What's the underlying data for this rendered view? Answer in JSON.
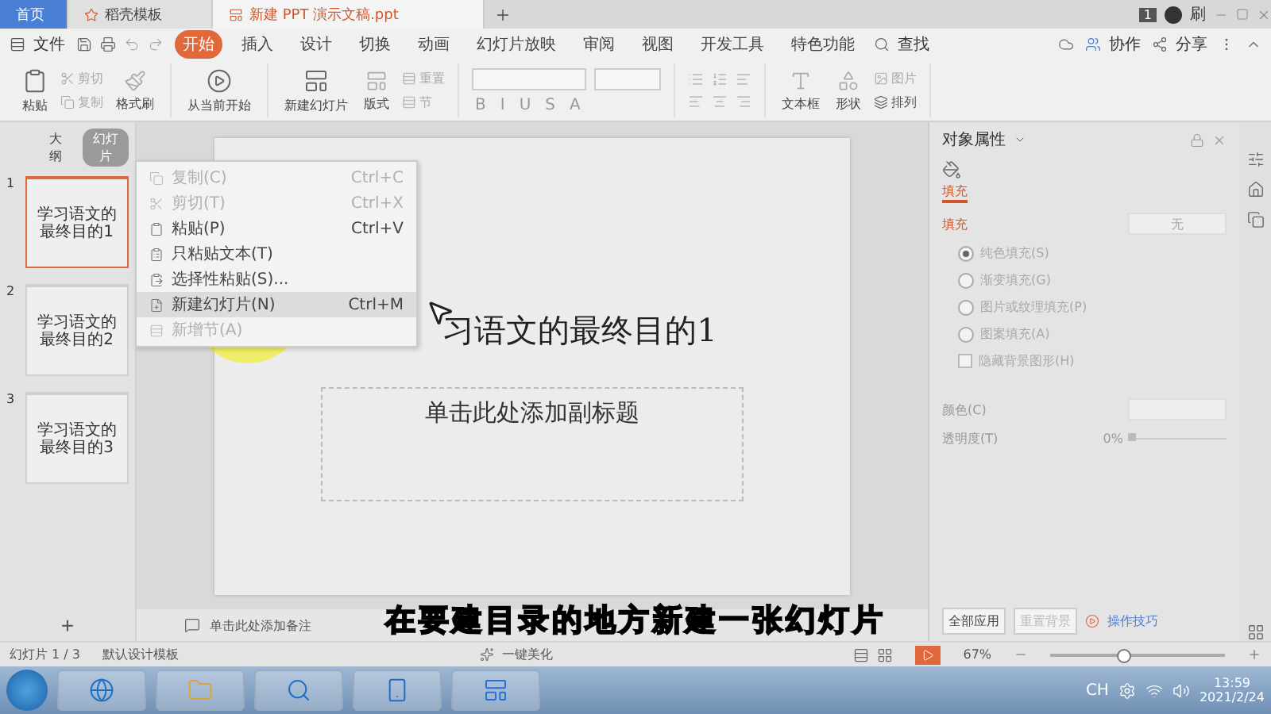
{
  "doc_tabs": [
    {
      "label": "首页",
      "kind": "home",
      "selected": false
    },
    {
      "label": "稻壳模板",
      "kind": "docer",
      "selected": false
    },
    {
      "label": "新建 PPT 演示文稿.ppt",
      "kind": "doc",
      "selected": true
    }
  ],
  "title_bar": {
    "badge": "1",
    "user": "刷"
  },
  "menu": {
    "file": "文件",
    "tabs": [
      {
        "label": "开始",
        "selected": true
      },
      {
        "label": "插入",
        "selected": false
      },
      {
        "label": "设计",
        "selected": false
      },
      {
        "label": "切换",
        "selected": false
      },
      {
        "label": "动画",
        "selected": false
      },
      {
        "label": "幻灯片放映",
        "selected": false
      },
      {
        "label": "审阅",
        "selected": false
      },
      {
        "label": "视图",
        "selected": false
      },
      {
        "label": "开发工具",
        "selected": false
      },
      {
        "label": "特色功能",
        "selected": false
      }
    ],
    "search": "查找",
    "collab": "协作",
    "share": "分享"
  },
  "ribbon": {
    "paste": "粘贴",
    "cut": "剪切",
    "copy": "复制",
    "format_painter": "格式刷",
    "play_from_current": "从当前开始",
    "new_slide": "新建幻灯片",
    "layout": "版式",
    "reset": "重置",
    "section": "节",
    "format_letters": [
      "B",
      "I",
      "U",
      "S",
      "A"
    ],
    "text_box": "文本框",
    "shape": "形状",
    "arrange": "排列",
    "picture": "图片"
  },
  "left_panel": {
    "tabs": [
      {
        "label": "大纲",
        "selected": false
      },
      {
        "label": "幻灯片",
        "selected": true
      }
    ],
    "slides": [
      {
        "number": "1",
        "text": "学习语文的最终目的1",
        "selected": true
      },
      {
        "number": "2",
        "text": "学习语文的最终目的2",
        "selected": false
      },
      {
        "number": "3",
        "text": "学习语文的最终目的3",
        "selected": false
      }
    ],
    "add": "+"
  },
  "context_menu": [
    {
      "label": "复制(C)",
      "shortcut": "Ctrl+C",
      "disabled": true,
      "selected": false
    },
    {
      "label": "剪切(T)",
      "shortcut": "Ctrl+X",
      "disabled": true,
      "selected": false
    },
    {
      "label": "粘贴(P)",
      "shortcut": "Ctrl+V",
      "disabled": false,
      "selected": false
    },
    {
      "label": "只粘贴文本(T)",
      "disabled": false,
      "selected": false
    },
    {
      "label": "选择性粘贴(S)...",
      "disabled": false,
      "selected": false
    },
    {
      "label": "新建幻灯片(N)",
      "shortcut": "Ctrl+M",
      "disabled": false,
      "selected": true
    },
    {
      "label": "新增节(A)",
      "disabled": true,
      "selected": false
    }
  ],
  "slide": {
    "title": "习语文的最终目的1",
    "subtitle": "单击此处添加副标题"
  },
  "notes": {
    "placeholder": "单击此处添加备注"
  },
  "properties": {
    "title": "对象属性",
    "tab": {
      "label": "填充",
      "selected": true
    },
    "section": "填充",
    "fill_value": "无",
    "fill_options": [
      {
        "label": "纯色填充(S)",
        "selected": true,
        "disabled": true
      },
      {
        "label": "渐变填充(G)",
        "selected": false,
        "disabled": true
      },
      {
        "label": "图片或纹理填充(P)",
        "selected": false,
        "disabled": true
      },
      {
        "label": "图案填充(A)",
        "selected": false,
        "disabled": true
      }
    ],
    "hide_background": {
      "label": "隐藏背景图形(H)",
      "checked": false
    },
    "color_label": "颜色(C)",
    "transparency_label": "透明度(T)",
    "transparency": {
      "reading": "0%",
      "level": 0
    },
    "buttons": [
      {
        "label": "全部应用",
        "disabled": false
      },
      {
        "label": "重置背景",
        "disabled": true
      }
    ],
    "tips": "操作技巧"
  },
  "status_bar": {
    "slide_count": "幻灯片 1 / 3",
    "template": "默认设计模板",
    "beautify": "一键美化",
    "zoom": "67%",
    "zoom_slider": {
      "level": 0.42
    }
  },
  "caption": "在要建目录的地方新建一张幻灯片",
  "taskbar": {
    "language": "CH",
    "time": "13:59",
    "date": "2021/2/24"
  }
}
